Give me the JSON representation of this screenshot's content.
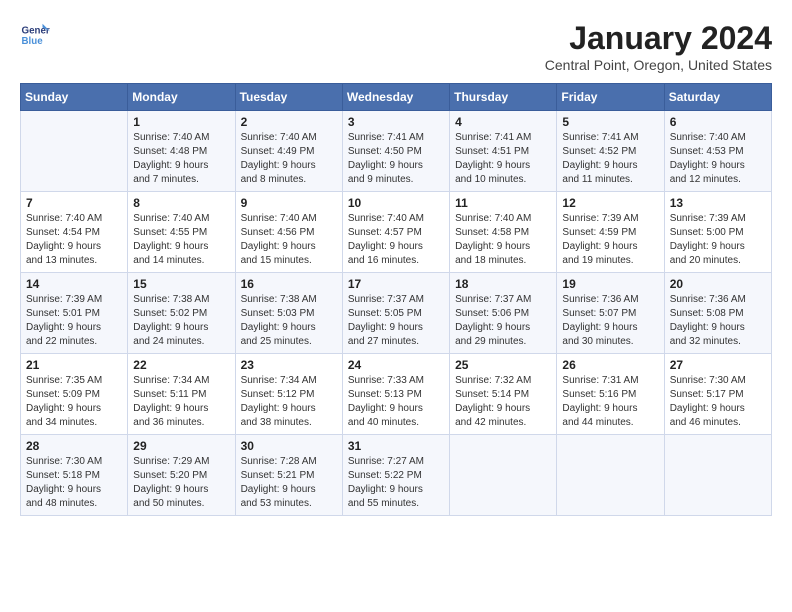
{
  "logo": {
    "line1": "General",
    "line2": "Blue"
  },
  "title": "January 2024",
  "location": "Central Point, Oregon, United States",
  "days_header": [
    "Sunday",
    "Monday",
    "Tuesday",
    "Wednesday",
    "Thursday",
    "Friday",
    "Saturday"
  ],
  "weeks": [
    [
      {
        "day": "",
        "info": ""
      },
      {
        "day": "1",
        "info": "Sunrise: 7:40 AM\nSunset: 4:48 PM\nDaylight: 9 hours\nand 7 minutes."
      },
      {
        "day": "2",
        "info": "Sunrise: 7:40 AM\nSunset: 4:49 PM\nDaylight: 9 hours\nand 8 minutes."
      },
      {
        "day": "3",
        "info": "Sunrise: 7:41 AM\nSunset: 4:50 PM\nDaylight: 9 hours\nand 9 minutes."
      },
      {
        "day": "4",
        "info": "Sunrise: 7:41 AM\nSunset: 4:51 PM\nDaylight: 9 hours\nand 10 minutes."
      },
      {
        "day": "5",
        "info": "Sunrise: 7:41 AM\nSunset: 4:52 PM\nDaylight: 9 hours\nand 11 minutes."
      },
      {
        "day": "6",
        "info": "Sunrise: 7:40 AM\nSunset: 4:53 PM\nDaylight: 9 hours\nand 12 minutes."
      }
    ],
    [
      {
        "day": "7",
        "info": "Sunrise: 7:40 AM\nSunset: 4:54 PM\nDaylight: 9 hours\nand 13 minutes."
      },
      {
        "day": "8",
        "info": "Sunrise: 7:40 AM\nSunset: 4:55 PM\nDaylight: 9 hours\nand 14 minutes."
      },
      {
        "day": "9",
        "info": "Sunrise: 7:40 AM\nSunset: 4:56 PM\nDaylight: 9 hours\nand 15 minutes."
      },
      {
        "day": "10",
        "info": "Sunrise: 7:40 AM\nSunset: 4:57 PM\nDaylight: 9 hours\nand 16 minutes."
      },
      {
        "day": "11",
        "info": "Sunrise: 7:40 AM\nSunset: 4:58 PM\nDaylight: 9 hours\nand 18 minutes."
      },
      {
        "day": "12",
        "info": "Sunrise: 7:39 AM\nSunset: 4:59 PM\nDaylight: 9 hours\nand 19 minutes."
      },
      {
        "day": "13",
        "info": "Sunrise: 7:39 AM\nSunset: 5:00 PM\nDaylight: 9 hours\nand 20 minutes."
      }
    ],
    [
      {
        "day": "14",
        "info": "Sunrise: 7:39 AM\nSunset: 5:01 PM\nDaylight: 9 hours\nand 22 minutes."
      },
      {
        "day": "15",
        "info": "Sunrise: 7:38 AM\nSunset: 5:02 PM\nDaylight: 9 hours\nand 24 minutes."
      },
      {
        "day": "16",
        "info": "Sunrise: 7:38 AM\nSunset: 5:03 PM\nDaylight: 9 hours\nand 25 minutes."
      },
      {
        "day": "17",
        "info": "Sunrise: 7:37 AM\nSunset: 5:05 PM\nDaylight: 9 hours\nand 27 minutes."
      },
      {
        "day": "18",
        "info": "Sunrise: 7:37 AM\nSunset: 5:06 PM\nDaylight: 9 hours\nand 29 minutes."
      },
      {
        "day": "19",
        "info": "Sunrise: 7:36 AM\nSunset: 5:07 PM\nDaylight: 9 hours\nand 30 minutes."
      },
      {
        "day": "20",
        "info": "Sunrise: 7:36 AM\nSunset: 5:08 PM\nDaylight: 9 hours\nand 32 minutes."
      }
    ],
    [
      {
        "day": "21",
        "info": "Sunrise: 7:35 AM\nSunset: 5:09 PM\nDaylight: 9 hours\nand 34 minutes."
      },
      {
        "day": "22",
        "info": "Sunrise: 7:34 AM\nSunset: 5:11 PM\nDaylight: 9 hours\nand 36 minutes."
      },
      {
        "day": "23",
        "info": "Sunrise: 7:34 AM\nSunset: 5:12 PM\nDaylight: 9 hours\nand 38 minutes."
      },
      {
        "day": "24",
        "info": "Sunrise: 7:33 AM\nSunset: 5:13 PM\nDaylight: 9 hours\nand 40 minutes."
      },
      {
        "day": "25",
        "info": "Sunrise: 7:32 AM\nSunset: 5:14 PM\nDaylight: 9 hours\nand 42 minutes."
      },
      {
        "day": "26",
        "info": "Sunrise: 7:31 AM\nSunset: 5:16 PM\nDaylight: 9 hours\nand 44 minutes."
      },
      {
        "day": "27",
        "info": "Sunrise: 7:30 AM\nSunset: 5:17 PM\nDaylight: 9 hours\nand 46 minutes."
      }
    ],
    [
      {
        "day": "28",
        "info": "Sunrise: 7:30 AM\nSunset: 5:18 PM\nDaylight: 9 hours\nand 48 minutes."
      },
      {
        "day": "29",
        "info": "Sunrise: 7:29 AM\nSunset: 5:20 PM\nDaylight: 9 hours\nand 50 minutes."
      },
      {
        "day": "30",
        "info": "Sunrise: 7:28 AM\nSunset: 5:21 PM\nDaylight: 9 hours\nand 53 minutes."
      },
      {
        "day": "31",
        "info": "Sunrise: 7:27 AM\nSunset: 5:22 PM\nDaylight: 9 hours\nand 55 minutes."
      },
      {
        "day": "",
        "info": ""
      },
      {
        "day": "",
        "info": ""
      },
      {
        "day": "",
        "info": ""
      }
    ]
  ]
}
